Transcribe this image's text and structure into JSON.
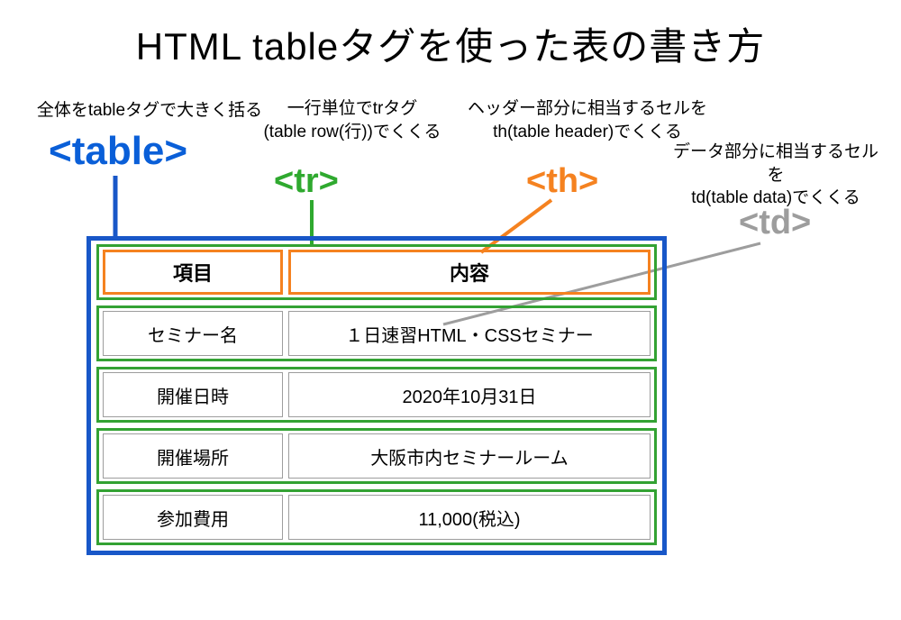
{
  "title": "HTML tableタグを使った表の書き方",
  "annotations": {
    "table": "全体をtableタグで大きく括る",
    "tr_l1": "一行単位でtrタグ",
    "tr_l2": "(table row(行))でくくる",
    "th_l1": "ヘッダー部分に相当するセルを",
    "th_l2": "th(table header)でくくる",
    "td_l1": "データ部分に相当するセルを",
    "td_l2": "td(table data)でくくる"
  },
  "tags": {
    "table": "<table>",
    "tr": "<tr>",
    "th": "<th>",
    "td": "<td>"
  },
  "table": {
    "headers": {
      "col1": "項目",
      "col2": "内容"
    },
    "rows": [
      {
        "col1": "セミナー名",
        "col2": "１日速習HTML・CSSセミナー"
      },
      {
        "col1": "開催日時",
        "col2": "2020年10月31日"
      },
      {
        "col1": "開催場所",
        "col2": "大阪市内セミナールーム"
      },
      {
        "col1": "参加費用",
        "col2": "11,000(税込)"
      }
    ]
  },
  "colors": {
    "table_border": "#1857c8",
    "tr_border": "#33a233",
    "th_border": "#f58220",
    "td_border": "#9d9d9d"
  }
}
